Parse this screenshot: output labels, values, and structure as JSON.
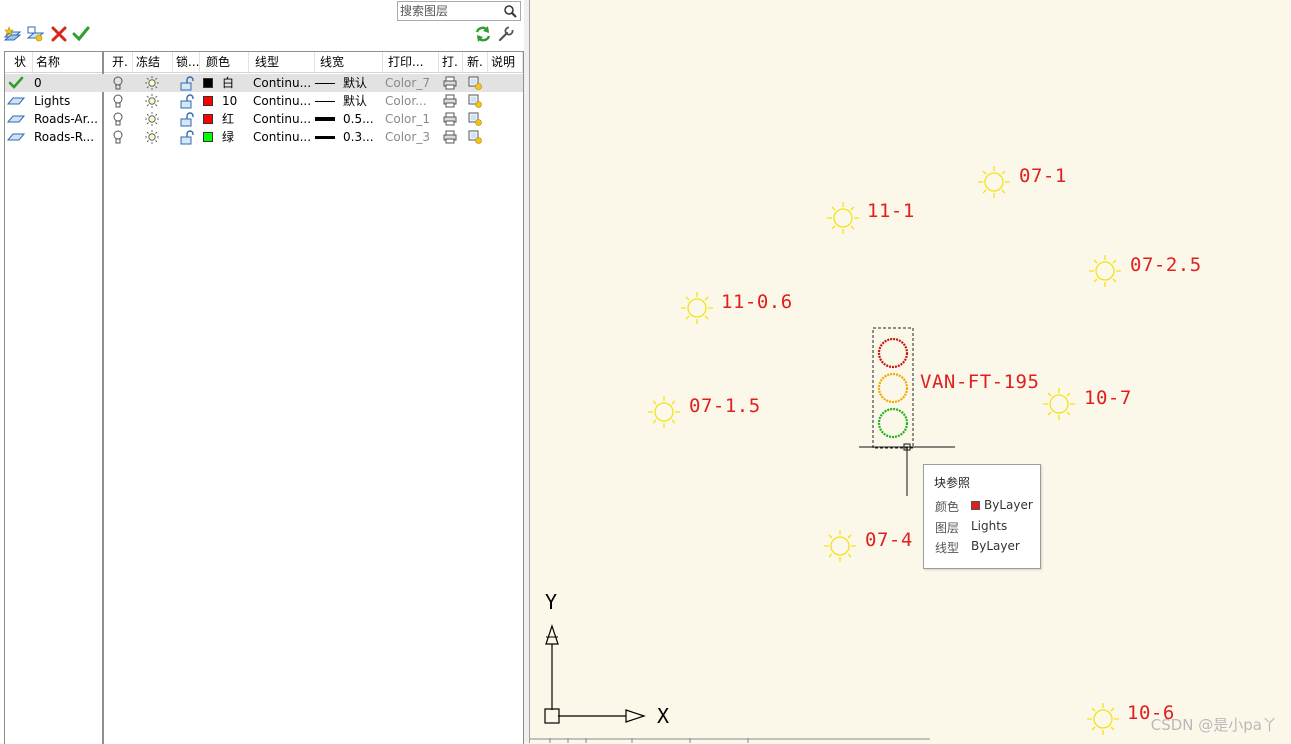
{
  "search": {
    "placeholder": "搜索图层"
  },
  "columns": [
    {
      "label": "状"
    },
    {
      "label": "名称"
    },
    {
      "label": "开."
    },
    {
      "label": "冻结"
    },
    {
      "label": "锁..."
    },
    {
      "label": "颜色"
    },
    {
      "label": "线型"
    },
    {
      "label": "线宽"
    },
    {
      "label": "打印..."
    },
    {
      "label": "打."
    },
    {
      "label": "新."
    },
    {
      "label": "说明"
    }
  ],
  "layers": [
    {
      "name": "0",
      "color_label": "白",
      "color_hex": "#000000",
      "linetype": "Continu...",
      "lineweight": "默认",
      "plot_style": "Color_7",
      "current": true
    },
    {
      "name": "Lights",
      "color_label": "10",
      "color_hex": "#ff0000",
      "linetype": "Continu...",
      "lineweight": "默认",
      "plot_style": "Color...",
      "current": false
    },
    {
      "name": "Roads-Ar...",
      "color_label": "红",
      "color_hex": "#ff0000",
      "linetype": "Continu...",
      "lineweight": "0.5...",
      "plot_style": "Color_1",
      "current": false
    },
    {
      "name": "Roads-R...",
      "color_label": "绿",
      "color_hex": "#00ff00",
      "linetype": "Continu...",
      "lineweight": "0.3...",
      "plot_style": "Color_3",
      "current": false
    }
  ],
  "canvas_labels": [
    "07-1",
    "11-1",
    "07-2.5",
    "11-0.6",
    "VAN-FT-195",
    "07-1.5",
    "10-7",
    "07-4",
    "10-6"
  ],
  "ucs": {
    "y_label": "Y",
    "x_label": "X"
  },
  "tooltip": {
    "title": "块参照",
    "rows": [
      {
        "key": "颜色",
        "value": "ByLayer",
        "swatch": "#e0201e"
      },
      {
        "key": "图层",
        "value": "Lights"
      },
      {
        "key": "线型",
        "value": "ByLayer"
      }
    ]
  },
  "watermark": "CSDN @是小pa丫",
  "colors": {
    "cad_red": "#e0201e",
    "sun_yellow": "#f2e21a",
    "canvas_bg": "#fbf8ea",
    "selected_row": "#e2e2e2"
  }
}
